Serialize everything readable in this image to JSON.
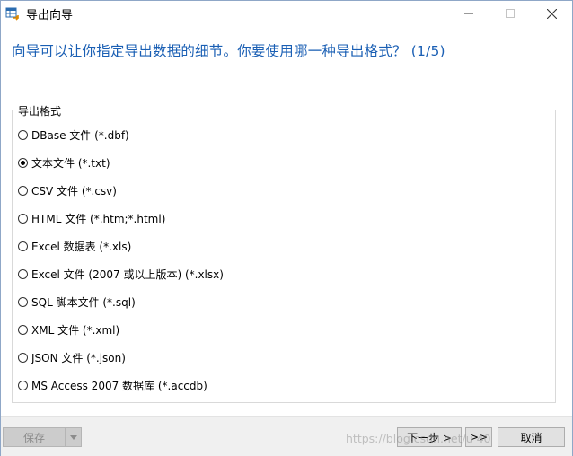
{
  "window": {
    "title": "导出向导",
    "icon": "table-export-icon"
  },
  "wizard": {
    "heading": "向导可以让你指定导出数据的细节。你要使用哪一种导出格式？ (1/5)"
  },
  "export_format": {
    "group_label": "导出格式",
    "selected_index": 1,
    "options": [
      {
        "label": "DBase 文件 (*.dbf)",
        "checked": false
      },
      {
        "label": "文本文件 (*.txt)",
        "checked": true
      },
      {
        "label": "CSV 文件 (*.csv)",
        "checked": false
      },
      {
        "label": "HTML 文件 (*.htm;*.html)",
        "checked": false
      },
      {
        "label": "Excel 数据表 (*.xls)",
        "checked": false
      },
      {
        "label": "Excel 文件 (2007 或以上版本) (*.xlsx)",
        "checked": false
      },
      {
        "label": "SQL 脚本文件 (*.sql)",
        "checked": false
      },
      {
        "label": "XML 文件 (*.xml)",
        "checked": false
      },
      {
        "label": "JSON 文件 (*.json)",
        "checked": false
      },
      {
        "label": "MS Access 2007 数据库 (*.accdb)",
        "checked": false
      }
    ]
  },
  "footer": {
    "save_label": "保存",
    "next_label": "下一步 >",
    "last_label": ">>",
    "cancel_label": "取消",
    "watermark": "https://blog.csdn.net/u 40"
  },
  "colors": {
    "heading": "#1a5fb4",
    "footer_bg": "#f0f0f0"
  }
}
